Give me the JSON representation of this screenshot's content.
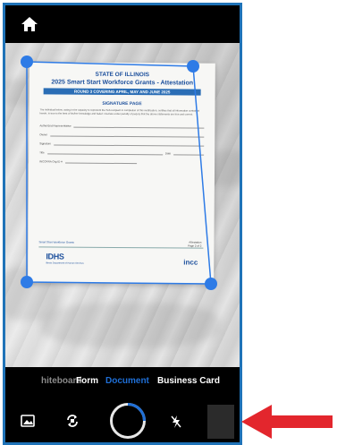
{
  "colors": {
    "frame": "#1f73b8",
    "accent": "#1f6fd6",
    "handles": "#2e7be6",
    "arrow": "#e3262d"
  },
  "topbar": {
    "home_icon": "home-icon"
  },
  "document": {
    "state": "STATE OF ILLINOIS",
    "title": "2025 Smart Start Workforce Grants - Attestation",
    "banner": "ROUND 3 COVERING APRIL, MAY AND JUNE 2025",
    "signature_heading": "SIGNATURE PAGE",
    "paragraph": "The individual below, acting in the capacity to represent the Sub-recipient in completion of this certification, certifies that all information contained herein, is true to the best of his/her knowledge and belief. I declare under penalty of perjury that the above statements are true and correct.",
    "fields": {
      "authorized_rep": "Authorized Representative",
      "owner": "Owner",
      "signature": "Signature",
      "title": "Title",
      "date": "Date",
      "incc_id": "INCCRRA Org ID #"
    },
    "footer_text": "Smart Start Workforce Grants",
    "page_label": "Attestation",
    "page_number": "Page 2 of 2",
    "logo_left": "IDHS",
    "logo_left_sub": "Illinois Department of Human Services",
    "logo_right": "incc"
  },
  "modes": {
    "whiteboard": "hiteboard",
    "form": "Form",
    "document": "Document",
    "business_card": "Business Card"
  },
  "controls": {
    "gallery_icon": "image-gallery-icon",
    "switch_camera_icon": "switch-camera-icon",
    "shutter": "shutter-button",
    "flash_icon": "flash-off-icon"
  }
}
